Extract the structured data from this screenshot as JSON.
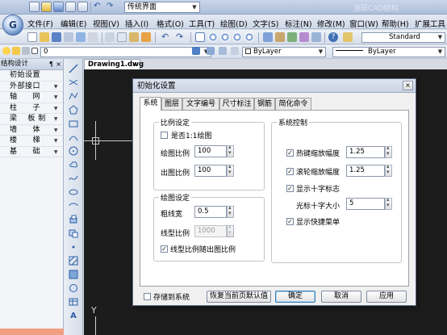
{
  "titlebar": {
    "profile": "传统界面",
    "app_title": "浩辰CAD结构"
  },
  "menus": [
    "文件(F)",
    "编辑(E)",
    "视图(V)",
    "插入(I)",
    "格式(O)",
    "工具(T)",
    "绘图(D)",
    "文字(S)",
    "标注(N)",
    "修改(M)",
    "窗口(W)",
    "帮助(H)",
    "扩展工具"
  ],
  "toolbar": {
    "textstyle": "Standard",
    "layer": "0",
    "color": "ByLayer",
    "linetype": "ByLayer"
  },
  "structure_panel": {
    "title": "结构设计",
    "pin": "¶",
    "close": "×",
    "items": [
      "初始设置",
      "外部接口",
      "轴　　网",
      "柱　　子",
      "梁 　板 制",
      "墙　　体",
      "楼　　梯",
      "基　　础"
    ]
  },
  "document_tab": {
    "name": "Drawing1.dwg",
    "close": "×"
  },
  "ucs": {
    "y_label": "Y"
  },
  "dialog": {
    "title": "初始化设置",
    "close": "×",
    "tabs": [
      "系统",
      "图层",
      "文字编号",
      "尺寸标注",
      "钢筋",
      "简化命令"
    ],
    "scale_group": {
      "title": "比例设定",
      "is_1_1_label": "是否1:1绘图",
      "is_1_1_checked": false,
      "draw_scale_label": "绘图比例",
      "draw_scale_value": "100",
      "output_scale_label": "出图比例",
      "output_scale_value": "100"
    },
    "draw_group": {
      "title": "绘图设定",
      "thick_line_label": "粗线宽",
      "thick_line_value": "0.5",
      "linetype_scale_label": "线型比例",
      "linetype_scale_value": "1000",
      "follow_label": "线型比例随出图比例",
      "follow_checked": true
    },
    "system_group": {
      "title": "系统控制",
      "hotkey_zoom_label": "热键缩放幅度",
      "hotkey_zoom_value": "1.25",
      "wheel_zoom_label": "滚轮缩放幅度",
      "wheel_zoom_value": "1.25",
      "show_cross_label": "显示十字标志",
      "cross_size_label": "光标十字大小",
      "cross_size_value": "5",
      "shortcut_menu_label": "显示快捷菜单"
    },
    "footer": {
      "save_to_system": "存储到系统",
      "restore_defaults": "恢复当前页默认值",
      "ok": "确定",
      "cancel": "取消",
      "apply": "应用"
    }
  }
}
